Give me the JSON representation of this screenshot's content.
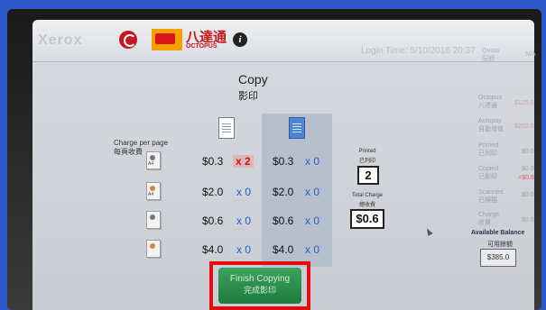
{
  "header": {
    "brand": "Xerox",
    "octopus_cn": "八達通",
    "octopus_en": "OCTOPUS",
    "login_time": "Login Time: 5/10/2016 20:37"
  },
  "main": {
    "title": "Copy",
    "title_cn": "影印",
    "charge_per_page": "Charge per page",
    "charge_per_page_cn": "每頁收費",
    "rows": [
      {
        "paper": "A4",
        "price1": "$0.3",
        "mult1": "x 2",
        "price2": "$0.3",
        "mult2": "x 0"
      },
      {
        "paper": "A4",
        "price1": "$2.0",
        "mult1": "x 0",
        "price2": "$2.0",
        "mult2": "x 0"
      },
      {
        "paper": "",
        "price1": "$0.6",
        "mult1": "x 0",
        "price2": "$0.6",
        "mult2": "x 0"
      },
      {
        "paper": "",
        "price1": "$4.0",
        "mult1": "x 0",
        "price2": "$4.0",
        "mult2": "x 0"
      }
    ],
    "printed_label": "Printed",
    "printed_label_cn": "已列印",
    "printed_value": "2",
    "total_charge_label": "Total Charge",
    "total_charge_label_cn": "總收費",
    "total_charge_value": "$0.6",
    "finish_label": "Finish Copying",
    "finish_label_cn": "完成影印"
  },
  "side": {
    "quota": "Quota",
    "quota_cn": "配額",
    "quota_value": "N/A",
    "octopus": "Octopus",
    "octopus_cn": "八達通",
    "octopus_value": "$125.0",
    "autopay": "Autopay",
    "autopay_cn": "自動增值",
    "autopay_value": "$250.0",
    "printed": "Printed",
    "printed_cn": "已列印",
    "printed_value": "$0.0",
    "copied": "Copied",
    "copied_cn": "已影印",
    "copied_value": "$0.0",
    "copied_delta": "+$0.6",
    "scanned": "Scanned",
    "scanned_cn": "已掃描",
    "scanned_value": "$0.0",
    "charge": "Charge",
    "charge_cn": "收費",
    "charge_value": "$0.0",
    "available_balance": "Available Balance",
    "available_balance_cn": "可用餘額",
    "available_balance_value": "$385.0"
  }
}
